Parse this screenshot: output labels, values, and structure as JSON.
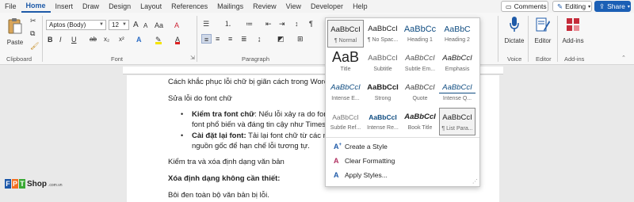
{
  "menubar": {
    "items": [
      "File",
      "Home",
      "Insert",
      "Draw",
      "Design",
      "Layout",
      "References",
      "Mailings",
      "Review",
      "View",
      "Developer",
      "Help"
    ],
    "active": "Home",
    "comments_label": "Comments",
    "editing_label": "Editing",
    "share_label": "Share"
  },
  "ribbon": {
    "clipboard": {
      "paste_label": "Paste",
      "group_label": "Clipboard"
    },
    "font": {
      "font_name": "Aptos (Body)",
      "font_size": "12",
      "grow": "A",
      "shrink": "A",
      "case": "Aa",
      "clear": "A",
      "bold": "B",
      "italic": "I",
      "underline": "U",
      "strike": "ab",
      "sub": "x₂",
      "sup": "x²",
      "effects": "A",
      "highlight": "✎",
      "color": "A",
      "group_label": "Font"
    },
    "paragraph": {
      "group_label": "Paragraph"
    },
    "voice": {
      "dictate_label": "Dictate",
      "group_label": "Voice"
    },
    "editor": {
      "label": "Editor",
      "group_label": "Editor"
    },
    "addins": {
      "label": "Add-ins",
      "group_label": "Add-ins"
    }
  },
  "styles_gallery": {
    "rows": [
      [
        {
          "preview": "AaBbCcI",
          "name": "¶ Normal",
          "style": "normal"
        },
        {
          "preview": "AaBbCcI",
          "name": "¶ No Spac...",
          "style": "normal"
        },
        {
          "preview": "AaBbCc",
          "name": "Heading 1",
          "style": "h1"
        },
        {
          "preview": "AaBbC",
          "name": "Heading 2",
          "style": "h2"
        }
      ],
      [
        {
          "preview": "AaB",
          "name": "Title",
          "style": "title"
        },
        {
          "preview": "AaBbCcI",
          "name": "Subtitle",
          "style": "subtitle"
        },
        {
          "preview": "AaBbCcI",
          "name": "Subtle Em...",
          "style": "subtle"
        },
        {
          "preview": "AaBbCcI",
          "name": "Emphasis",
          "style": "emph"
        }
      ],
      [
        {
          "preview": "AaBbCcI",
          "name": "Intense E...",
          "style": "intense"
        },
        {
          "preview": "AaBbCcI",
          "name": "Strong",
          "style": "strong"
        },
        {
          "preview": "AaBbCcI",
          "name": "Quote",
          "style": "quote"
        },
        {
          "preview": "AaBbCcI",
          "name": "Intense Q...",
          "style": "intenseq"
        }
      ],
      [
        {
          "preview": "AaBbCcI",
          "name": "Subtle Ref...",
          "style": "subref"
        },
        {
          "preview": "AaBbCcI",
          "name": "Intense Re...",
          "style": "intref"
        },
        {
          "preview": "AaBbCcI",
          "name": "Book Title",
          "style": "book"
        },
        {
          "preview": "AaBbCcI",
          "name": "¶ List Para...",
          "style": "normal"
        }
      ]
    ],
    "actions": [
      {
        "label": "Create a Style",
        "icon": "A+"
      },
      {
        "label": "Clear Formatting",
        "icon": "A"
      },
      {
        "label": "Apply Styles...",
        "icon": "A"
      }
    ]
  },
  "document": {
    "line1": "Cách khắc phục lỗi chữ bị giãn cách trong Word",
    "line2": "Sửa lỗi do font chữ",
    "b1_bold": "Kiểm tra font chữ",
    "b1_text": ": Nếu lỗi xảy ra do font c",
    "b1_cont": "font phổ biến và đáng tin cậy như Times N",
    "b2_bold": "Cài đặt lại font:",
    "b2_text": " Tải lại font chữ từ các ngu",
    "b2_cont": "nguồn gốc để hạn chế lỗi tương tự.",
    "line3": "Kiểm tra và xóa định dạng văn bản",
    "line4": "Xóa định dạng không cần thiết:",
    "line5": "Bôi đen toàn bộ văn bản bị lỗi."
  },
  "logo": {
    "letters": [
      "F",
      "P",
      "T"
    ],
    "text": "Shop",
    "suffix": ".com.vn"
  },
  "colors": {
    "accent": "#1e5aa8",
    "fpt_orange": "#f36f21",
    "fpt_blue": "#1a56a8",
    "fpt_green": "#3aa935"
  }
}
